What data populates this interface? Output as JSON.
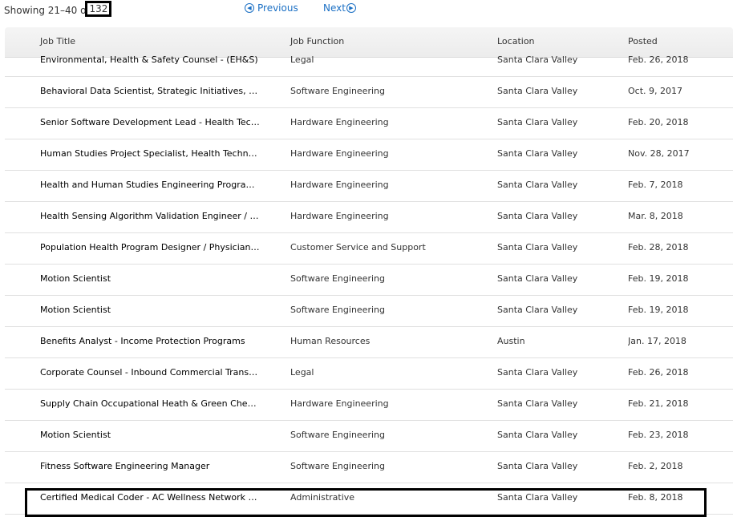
{
  "pagination": {
    "showing_prefix": "Showing 21–40 o",
    "total": "132",
    "previous_label": "Previous",
    "next_label": "Next",
    "prev_icon": "◀",
    "next_icon": "▶"
  },
  "table": {
    "headers": [
      "Job Title",
      "Job Function",
      "Location",
      "Posted"
    ],
    "rows": [
      {
        "title": "Environmental, Health & Safety Counsel - (EH&S)",
        "function": "Legal",
        "location": "Santa Clara Valley",
        "posted": "Feb. 26, 2018"
      },
      {
        "title": "Behavioral Data Scientist, Strategic Initiatives, He…",
        "function": "Software Engineering",
        "location": "Santa Clara Valley",
        "posted": "Oct. 9, 2017"
      },
      {
        "title": "Senior Software Development Lead - Health Tech…",
        "function": "Hardware Engineering",
        "location": "Santa Clara Valley",
        "posted": "Feb. 20, 2018"
      },
      {
        "title": "Human Studies Project Specialist, Health Technol…",
        "function": "Hardware Engineering",
        "location": "Santa Clara Valley",
        "posted": "Nov. 28, 2017"
      },
      {
        "title": "Health and Human Studies Engineering Program …",
        "function": "Hardware Engineering",
        "location": "Santa Clara Valley",
        "posted": "Feb. 7, 2018"
      },
      {
        "title": "Health Sensing Algorithm Validation Engineer / D…",
        "function": "Hardware Engineering",
        "location": "Santa Clara Valley",
        "posted": "Mar. 8, 2018"
      },
      {
        "title": "Population Health Program Designer / Physician -…",
        "function": "Customer Service and Support",
        "location": "Santa Clara Valley",
        "posted": "Feb. 28, 2018"
      },
      {
        "title": "Motion Scientist",
        "function": "Software Engineering",
        "location": "Santa Clara Valley",
        "posted": "Feb. 19, 2018"
      },
      {
        "title": "Motion Scientist",
        "function": "Software Engineering",
        "location": "Santa Clara Valley",
        "posted": "Feb. 19, 2018"
      },
      {
        "title": "Benefits Analyst - Income Protection Programs",
        "function": "Human Resources",
        "location": "Austin",
        "posted": "Jan. 17, 2018"
      },
      {
        "title": "Corporate Counsel - Inbound Commercial Transa…",
        "function": "Legal",
        "location": "Santa Clara Valley",
        "posted": "Feb. 26, 2018"
      },
      {
        "title": "Supply Chain Occupational Heath & Green Chemi…",
        "function": "Hardware Engineering",
        "location": "Santa Clara Valley",
        "posted": "Feb. 21, 2018"
      },
      {
        "title": "Motion Scientist",
        "function": "Software Engineering",
        "location": "Santa Clara Valley",
        "posted": "Feb. 23, 2018"
      },
      {
        "title": "Fitness Software Engineering Manager",
        "function": "Software Engineering",
        "location": "Santa Clara Valley",
        "posted": "Feb. 2, 2018"
      },
      {
        "title": "Certified Medical Coder - AC Wellness Network LLC",
        "function": "Administrative",
        "location": "Santa Clara Valley",
        "posted": "Feb. 8, 2018"
      }
    ]
  },
  "colors": {
    "link": "#1a6fc4",
    "row_border": "#e0e0e0",
    "header_bg": "#f0f0f0"
  }
}
